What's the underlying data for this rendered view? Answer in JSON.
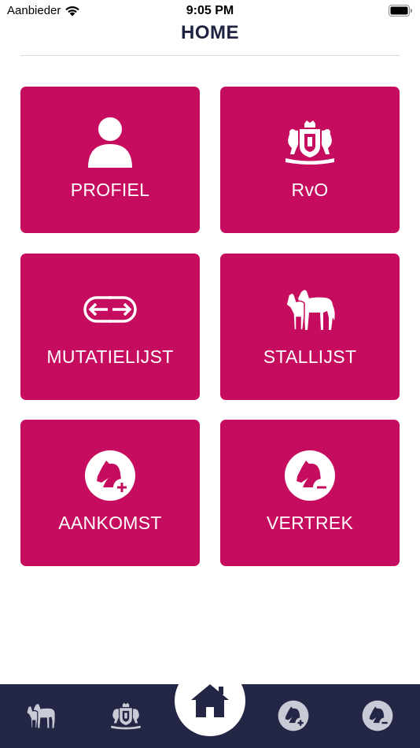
{
  "status_bar": {
    "carrier": "Aanbieder",
    "time": "9:05 PM"
  },
  "header": {
    "title": "HOME"
  },
  "tiles": [
    {
      "label": "PROFIEL",
      "icon": "person-icon"
    },
    {
      "label": "RvO",
      "icon": "royal-coat-of-arms-icon"
    },
    {
      "label": "MUTATIELIJST",
      "icon": "transfer-arrows-icon"
    },
    {
      "label": "STALLIJST",
      "icon": "horses-icon"
    },
    {
      "label": "AANKOMST",
      "icon": "horse-head-plus-icon"
    },
    {
      "label": "VERTREK",
      "icon": "horse-head-minus-icon"
    }
  ],
  "tab_bar": {
    "items": [
      {
        "icon": "horses-icon"
      },
      {
        "icon": "royal-coat-of-arms-icon"
      },
      {
        "icon": "home-icon",
        "selected": true
      },
      {
        "icon": "horse-head-plus-icon"
      },
      {
        "icon": "horse-head-minus-icon"
      }
    ]
  },
  "colors": {
    "tile": "#c60c5e",
    "tab_bar": "#232644",
    "tab_icon": "#c8cad6",
    "title": "#1d2340"
  }
}
